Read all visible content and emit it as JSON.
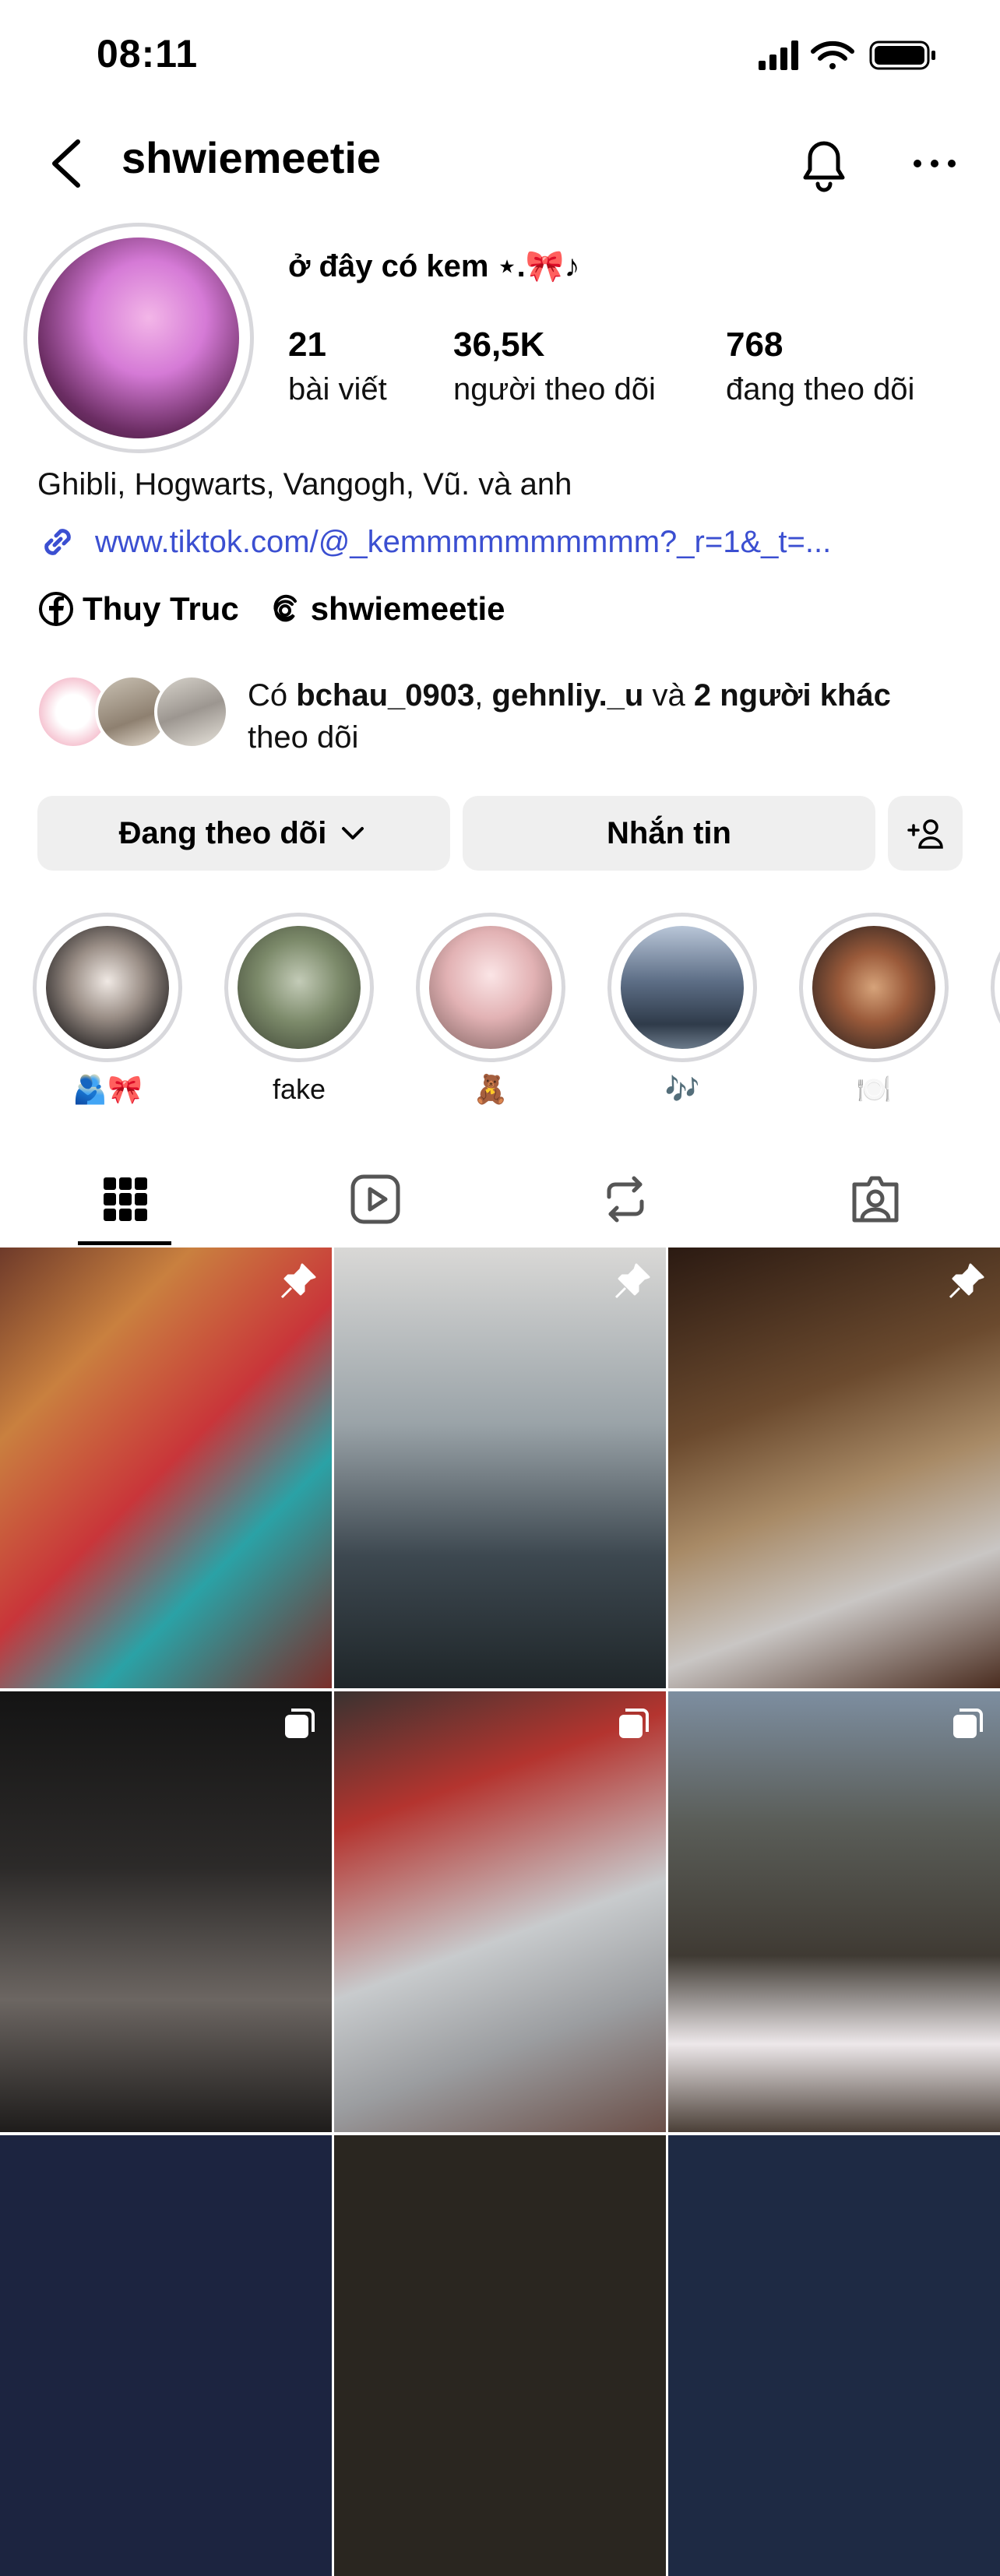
{
  "status_bar": {
    "time": "08:11"
  },
  "header": {
    "username": "shwiemeetie"
  },
  "profile": {
    "display_name": "ở đây có kem ⋆.🎀♪",
    "stats": {
      "posts": {
        "value": "21",
        "label": "bài viết"
      },
      "followers": {
        "value": "36,5K",
        "label": "người theo dõi"
      },
      "following": {
        "value": "768",
        "label": "đang theo dõi"
      }
    },
    "bio": "Ghibli, Hogwarts, Vangogh, Vũ. và anh",
    "link": "www.tiktok.com/@_kemmmmmmmmmm?_r=1&_t=...",
    "facebook": "Thuy Truc",
    "threads": "shwiemeetie",
    "followed_by": {
      "prefix": "Có ",
      "user1": "bchau_0903",
      "sep": ", ",
      "user2": "gehnliy._u",
      "and": " và ",
      "others": "2 người khác",
      "suffix": "theo dõi"
    }
  },
  "actions": {
    "following_label": "Đang theo dõi",
    "message_label": "Nhắn tin"
  },
  "highlights": [
    {
      "label": "🫂🎀"
    },
    {
      "label": "fake"
    },
    {
      "label": "🧸"
    },
    {
      "label": "🎶"
    },
    {
      "label": "🍽️"
    }
  ],
  "tabs": [
    "grid-icon",
    "reels-icon",
    "reposts-icon",
    "tagged-icon"
  ],
  "colors": {
    "link": "#3b4fd1",
    "button_bg": "#efefef",
    "ring": "#d8d8dc"
  }
}
